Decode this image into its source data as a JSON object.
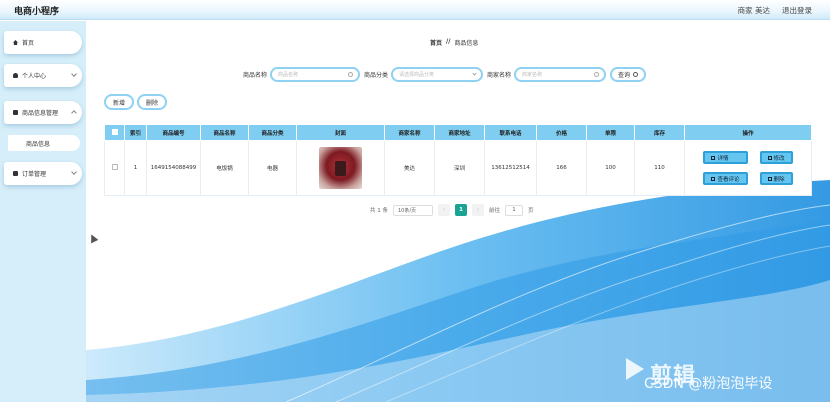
{
  "app": {
    "title": "电商小程序"
  },
  "header": {
    "user": "商家 美达",
    "logout": "退出登录"
  },
  "sidebar": {
    "items": [
      {
        "label": "首页"
      },
      {
        "label": "个人中心"
      },
      {
        "label": "商品信息管理"
      },
      {
        "label": "商品信息"
      },
      {
        "label": "订单管理"
      }
    ]
  },
  "breadcrumb": {
    "home": "首页",
    "sep": "//",
    "current": "商品信息"
  },
  "search": {
    "name_label": "商品名称",
    "name_placeholder": "商品名称",
    "category_label": "商品分类",
    "category_placeholder": "请选择商品分类",
    "merchant_label": "商家名称",
    "merchant_placeholder": "商家名称",
    "query_button": "查询"
  },
  "actions": {
    "add": "新增",
    "delete": "删除"
  },
  "table": {
    "headers": [
      "索引",
      "商品编号",
      "商品名称",
      "商品分类",
      "封面",
      "商家名称",
      "商家地址",
      "联系电话",
      "价格",
      "单限",
      "库存",
      "操作"
    ],
    "rows": [
      {
        "index": "1",
        "code": "1649154088499",
        "name": "电饭锅",
        "category": "电器",
        "merchant": "美达",
        "address": "深圳",
        "phone": "13612512514",
        "price": "166",
        "limit": "100",
        "stock": "110"
      }
    ],
    "ops": {
      "detail": "详情",
      "edit": "修改",
      "review": "查看评论",
      "delete": "删除"
    }
  },
  "pagination": {
    "total": "共 1 条",
    "page_size": "10条/页",
    "current": "1",
    "goto_label": "前往",
    "goto_value": "1",
    "page_suffix": "页"
  },
  "watermark": {
    "text": "剪辑",
    "csdn": "CSDN @粉泡泡毕设"
  }
}
